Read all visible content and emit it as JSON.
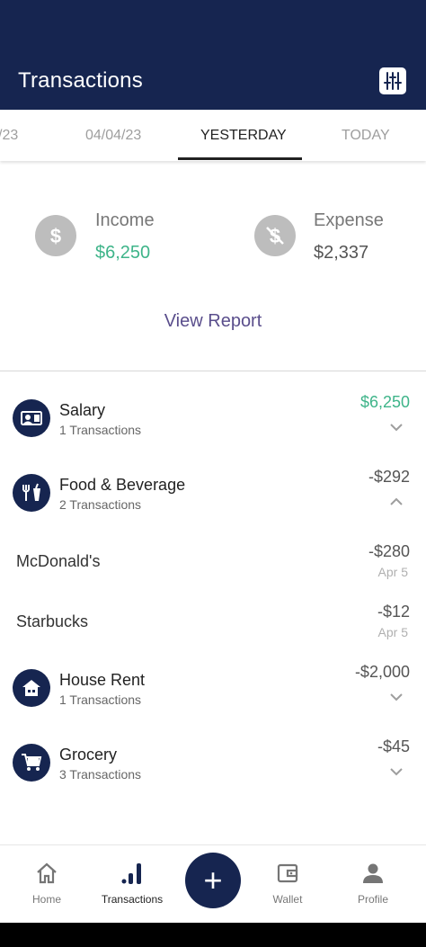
{
  "header": {
    "title": "Transactions",
    "filter_icon": "sliders-icon"
  },
  "tabs": [
    {
      "label": "/23"
    },
    {
      "label": "04/04/23"
    },
    {
      "label": "YESTERDAY",
      "active": true
    },
    {
      "label": "TODAY"
    }
  ],
  "summary": {
    "income": {
      "label": "Income",
      "value": "$6,250",
      "icon": "dollar-icon",
      "color": "#3eb489"
    },
    "expense": {
      "label": "Expense",
      "value": "$2,337",
      "icon": "dollar-crossed-icon",
      "color": "#555555"
    }
  },
  "view_report_label": "View Report",
  "categories": [
    {
      "name": "Salary",
      "count": "1 Transactions",
      "amount": "$6,250",
      "icon": "salary-icon",
      "expanded": false
    },
    {
      "name": "Food & Beverage",
      "count": "2 Transactions",
      "amount": "-$292",
      "icon": "food-icon",
      "expanded": true,
      "items": [
        {
          "name": "McDonald's",
          "amount": "-$280",
          "date": "Apr 5"
        },
        {
          "name": "Starbucks",
          "amount": "-$12",
          "date": "Apr 5"
        }
      ]
    },
    {
      "name": "House Rent",
      "count": "1 Transactions",
      "amount": "-$2,000",
      "icon": "house-icon",
      "expanded": false
    },
    {
      "name": "Grocery",
      "count": "3 Transactions",
      "amount": "-$45",
      "icon": "cart-icon",
      "expanded": false
    }
  ],
  "bottom_nav": [
    {
      "label": "Home",
      "icon": "home-icon"
    },
    {
      "label": "Transactions",
      "icon": "bar-chart-icon",
      "active": true
    },
    {
      "label": "Wallet",
      "icon": "wallet-icon"
    },
    {
      "label": "Profile",
      "icon": "person-icon"
    }
  ],
  "fab_label": "+",
  "colors": {
    "primary": "#162550",
    "income": "#3eb489",
    "link": "#5a4e8c"
  }
}
